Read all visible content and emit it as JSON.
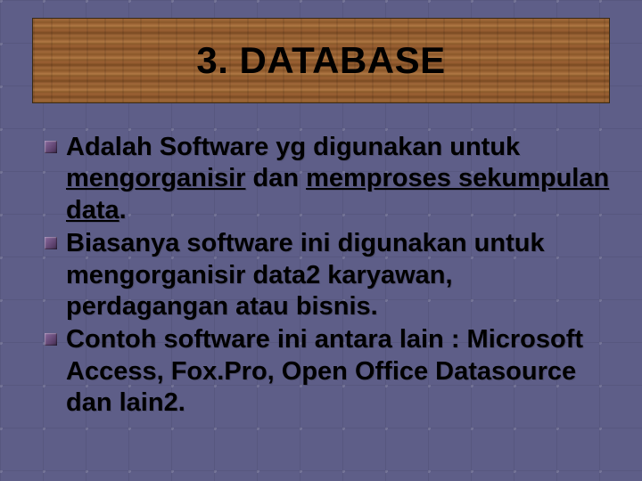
{
  "slide": {
    "title": "3. DATABASE",
    "bullets": [
      {
        "segments": [
          {
            "text": "Adalah Software yg digunakan untuk ",
            "u": false
          },
          {
            "text": "mengorganisir",
            "u": true
          },
          {
            "text": " dan ",
            "u": false
          },
          {
            "text": "memproses sekumpulan data",
            "u": true
          },
          {
            "text": ".",
            "u": false
          }
        ]
      },
      {
        "segments": [
          {
            "text": "Biasanya software ini digunakan untuk mengorganisir data2 karyawan, perdagangan atau bisnis.",
            "u": false
          }
        ]
      },
      {
        "segments": [
          {
            "text": "Contoh software ini antara lain : Microsoft Access, Fox.Pro, Open Office Datasource dan lain2.",
            "u": false
          }
        ]
      }
    ]
  }
}
